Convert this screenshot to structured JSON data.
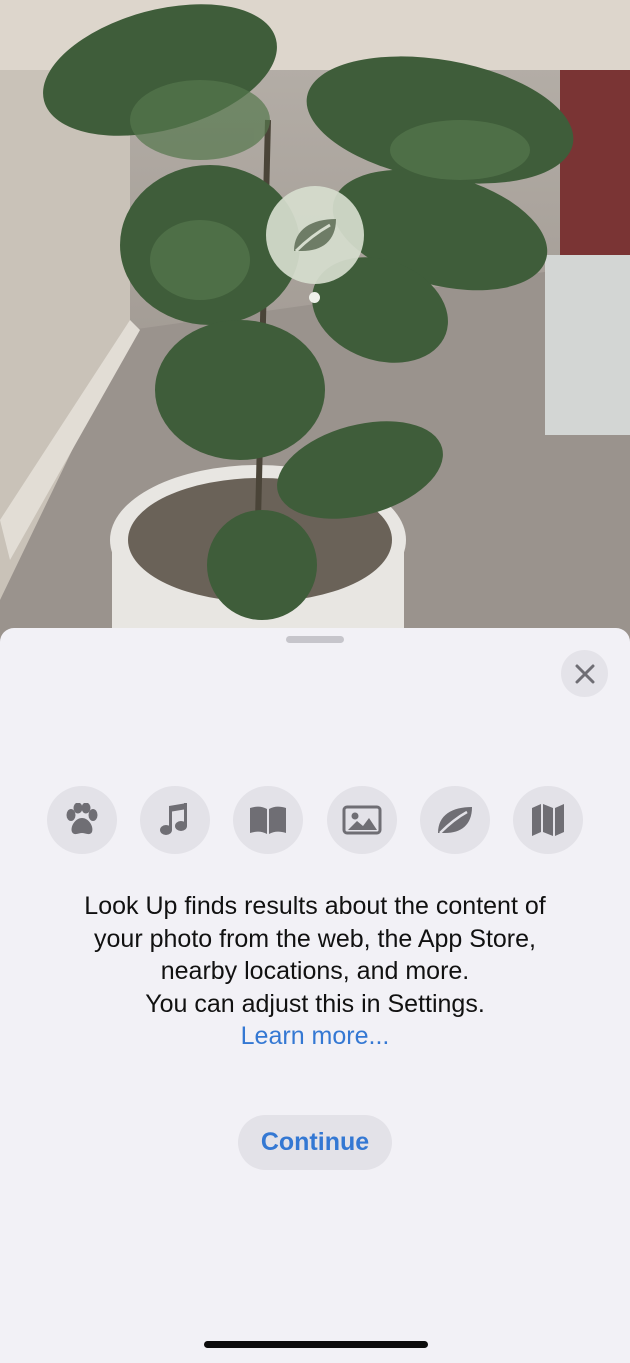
{
  "photo": {
    "subject_badge_icon": "leaf-icon"
  },
  "sheet": {
    "close_icon": "close-icon",
    "categories": [
      {
        "icon": "paw-icon"
      },
      {
        "icon": "music-note-icon"
      },
      {
        "icon": "book-icon"
      },
      {
        "icon": "photo-icon"
      },
      {
        "icon": "leaf-icon"
      },
      {
        "icon": "map-icon"
      }
    ],
    "info_lines": [
      "Look Up finds results about the content of",
      "your photo from the web, the App Store,",
      "nearby locations, and more.",
      "You can adjust this in Settings."
    ],
    "learn_more": "Learn more...",
    "continue_label": "Continue",
    "accent_color": "#3478d3",
    "icon_color": "#6f6e74"
  }
}
